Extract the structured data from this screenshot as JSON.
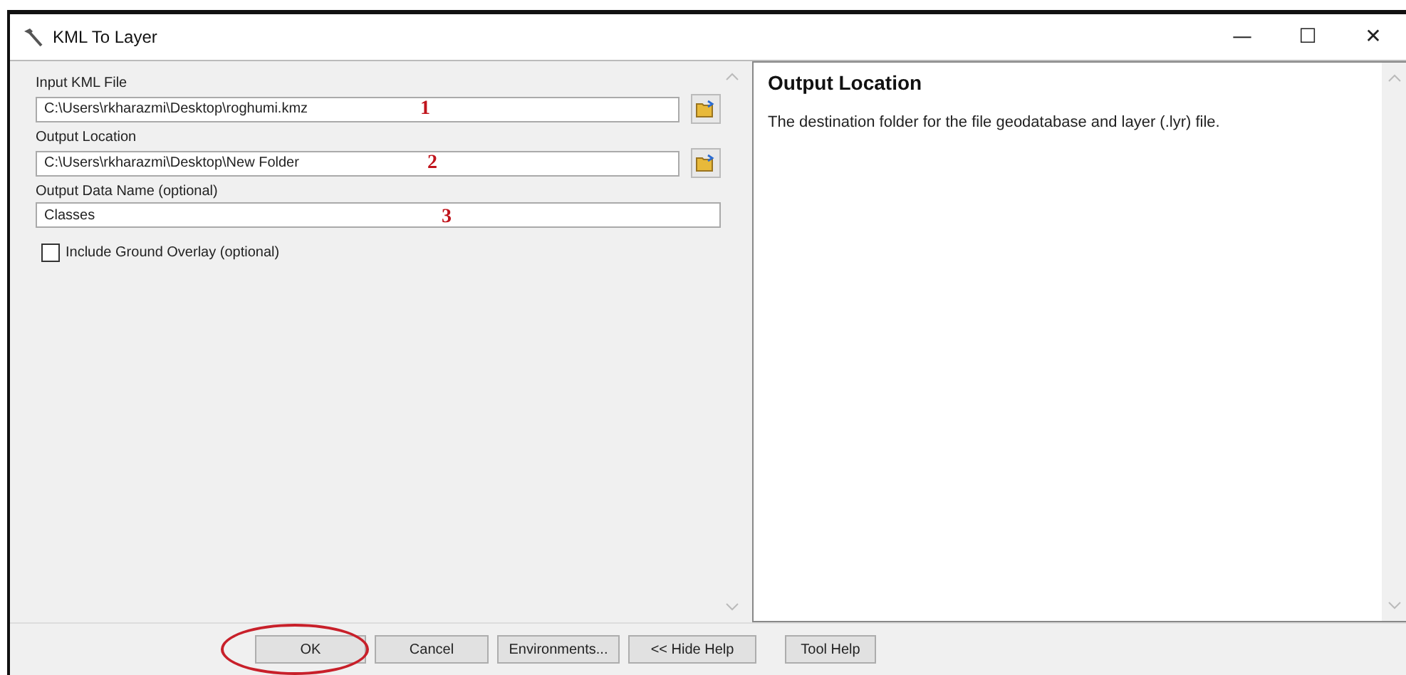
{
  "window": {
    "title": "KML To Layer",
    "controls": [
      "—",
      "☐",
      "✕"
    ]
  },
  "form": {
    "fields": [
      {
        "label": "Input KML File",
        "value": "C:\\Users\\rkharazmi\\Desktop\\roghumi.kmz",
        "browse": true,
        "annotation": "1"
      },
      {
        "label": "Output Location",
        "value": "C:\\Users\\rkharazmi\\Desktop\\New Folder",
        "browse": true,
        "annotation": "2"
      },
      {
        "label": "Output Data Name (optional)",
        "value": "Classes",
        "browse": false,
        "annotation": "3"
      }
    ],
    "checkbox": {
      "label": "Include Ground Overlay (optional)",
      "checked": false
    }
  },
  "help": {
    "title": "Output Location",
    "text": "The destination folder for the file geodatabase and layer (.lyr) file."
  },
  "buttons": [
    {
      "label": "OK",
      "circled": true
    },
    {
      "label": "Cancel",
      "circled": false
    },
    {
      "label": "Environments...",
      "circled": false
    },
    {
      "label": "<< Hide Help",
      "circled": false
    },
    {
      "label": "Tool Help",
      "circled": false
    }
  ]
}
